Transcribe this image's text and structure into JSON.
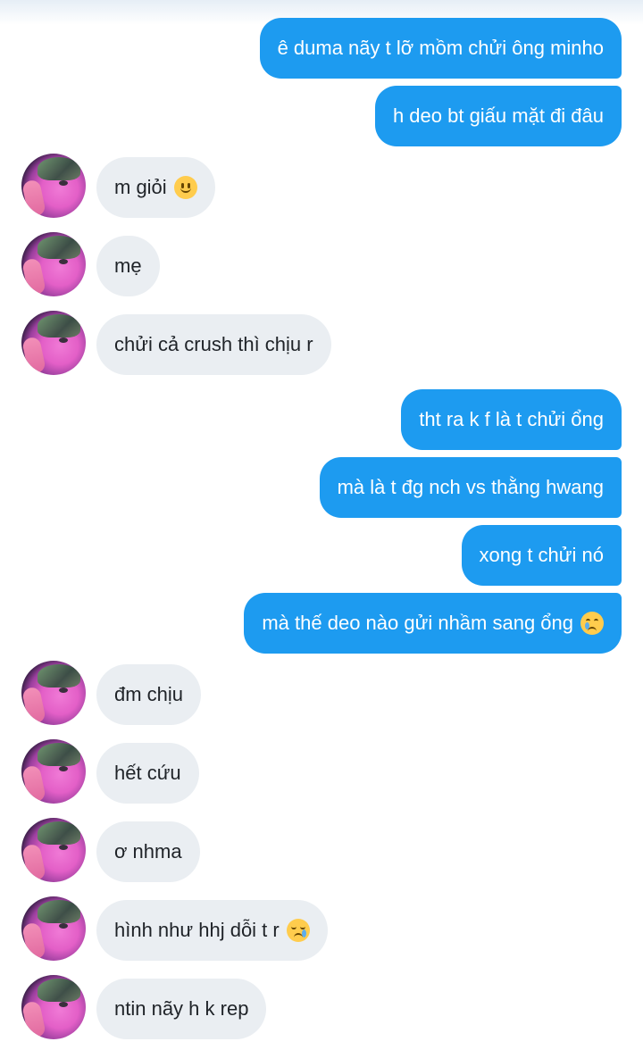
{
  "conversation": {
    "messages": [
      {
        "id": "m1",
        "direction": "outgoing",
        "text": "ê duma nãy t lỡ mồm chửi ông minho"
      },
      {
        "id": "m2",
        "direction": "outgoing",
        "text": "h deo bt giấu mặt đi đâu"
      },
      {
        "id": "m3",
        "direction": "incoming",
        "text": "m giỏi",
        "emoji": "slightly-smiling-face"
      },
      {
        "id": "m4",
        "direction": "incoming",
        "text": "mẹ"
      },
      {
        "id": "m5",
        "direction": "incoming",
        "text": "chửi cả crush thì chịu r"
      },
      {
        "id": "m6",
        "direction": "outgoing",
        "text": "tht ra k f là t chửi ổng"
      },
      {
        "id": "m7",
        "direction": "outgoing",
        "text": "mà là t đg nch vs thằng hwang"
      },
      {
        "id": "m8",
        "direction": "outgoing",
        "text": "xong t chửi nó"
      },
      {
        "id": "m9",
        "direction": "outgoing",
        "text": "mà thế deo nào gửi nhầm sang ổng",
        "emoji": "face-holding-back-tears"
      },
      {
        "id": "m10",
        "direction": "incoming",
        "text": "đm chịu"
      },
      {
        "id": "m11",
        "direction": "incoming",
        "text": "hết cứu"
      },
      {
        "id": "m12",
        "direction": "incoming",
        "text": "ơ nhma"
      },
      {
        "id": "m13",
        "direction": "incoming",
        "text": "hình như hhj dỗi t r",
        "emoji": "crying-face"
      },
      {
        "id": "m14",
        "direction": "incoming",
        "text": "ntin nãy h k rep"
      }
    ]
  },
  "colors": {
    "outgoing_bubble": "#1d9bf0",
    "incoming_bubble": "#eaeef2",
    "background": "#ffffff"
  }
}
